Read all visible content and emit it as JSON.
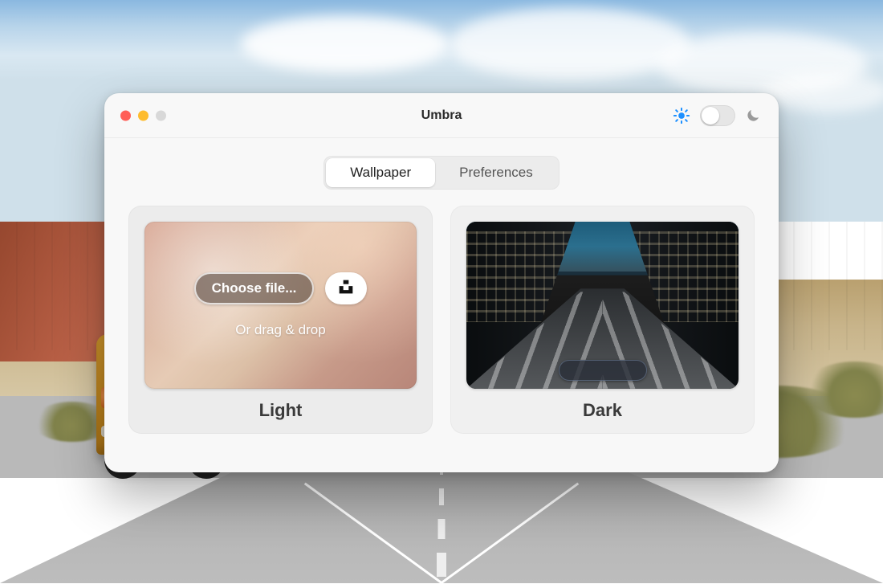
{
  "window": {
    "title": "Umbra"
  },
  "tabs": {
    "wallpaper": "Wallpaper",
    "preferences": "Preferences"
  },
  "panels": {
    "light": {
      "label": "Light",
      "choose_label": "Choose file...",
      "drag_label": "Or drag & drop"
    },
    "dark": {
      "label": "Dark"
    }
  },
  "colors": {
    "accent_sun": "#1e90ff",
    "moon_inactive": "#9a9a9a"
  }
}
